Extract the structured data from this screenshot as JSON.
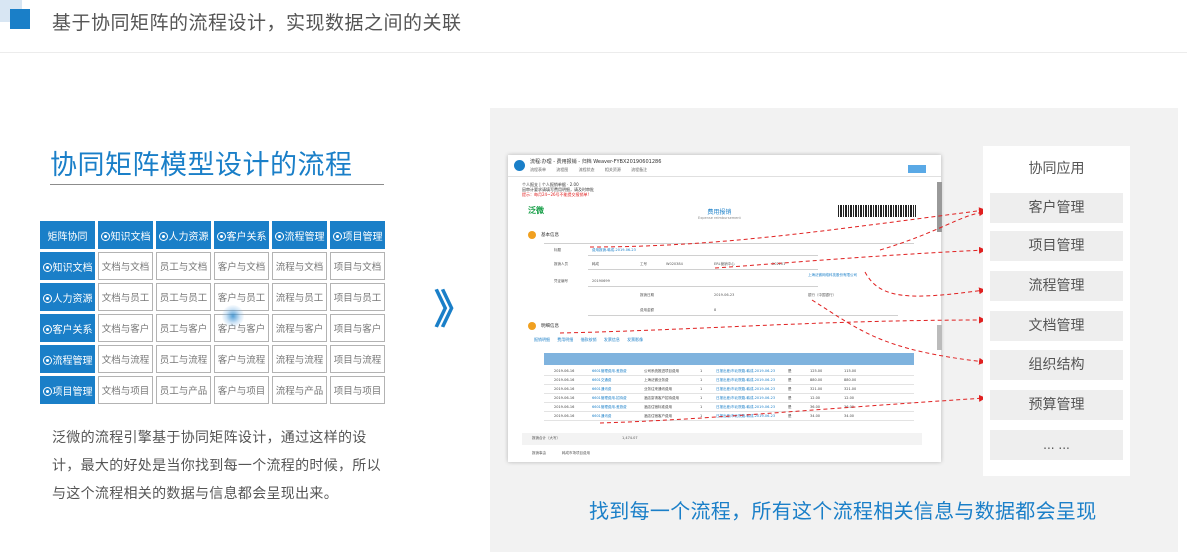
{
  "header": {
    "title": "基于协同矩阵的流程设计，实现数据之间的关联"
  },
  "section": {
    "title": "协同矩阵模型设计的流程"
  },
  "matrix": {
    "corner": "矩阵协同",
    "columns": [
      "知识文档",
      "人力资源",
      "客户关系",
      "流程管理",
      "项目管理"
    ],
    "rows": [
      {
        "label": "知识文档",
        "cells": [
          "文档与文档",
          "员工与文档",
          "客户与文档",
          "流程与文档",
          "项目与文档"
        ]
      },
      {
        "label": "人力资源",
        "cells": [
          "文档与员工",
          "员工与员工",
          "客户与员工",
          "流程与员工",
          "项目与员工"
        ]
      },
      {
        "label": "客户关系",
        "cells": [
          "文档与客户",
          "员工与客户",
          "客户与客户",
          "流程与客户",
          "项目与客户"
        ]
      },
      {
        "label": "流程管理",
        "cells": [
          "文档与流程",
          "员工与流程",
          "客户与流程",
          "流程与流程",
          "项目与流程"
        ]
      },
      {
        "label": "项目管理",
        "cells": [
          "文档与项目",
          "员工与产品",
          "客户与项目",
          "流程与产品",
          "项目与项目"
        ]
      }
    ]
  },
  "description": "泛微的流程引擎基于协同矩阵设计，通过这样的设计，最大的好处是当你找到每一个流程的时候，所以与这个流程相关的数据与信息都会呈现出来。",
  "arrow_glyph": "》",
  "screenshot": {
    "window_title": "流程:办理 - 费用报销 - 归档 Weaver-FYBX20190601286",
    "tabs": [
      "流程表单",
      "流程图",
      "流程状态",
      "相关资源",
      "流程备注"
    ],
    "meta_line1": "个人报支 | 个人报销单据 · 2.00",
    "meta_line2": "因审计要求请填写费用明细，请及时审批",
    "meta_warning": "提示：每月24~26号不能提交报销单!",
    "brand": "泛微",
    "doc_title": "费用报销",
    "doc_subtitle": "Expense reimbursement",
    "section_basic": "基本信息",
    "section_detail": "明细信息",
    "subtabs": [
      "报销明细",
      "费用明细",
      "借款核销",
      "发票信息",
      "发票影像"
    ],
    "fields": [
      {
        "label": "标题",
        "value": "费用报销-韩成-2019-06-23"
      },
      {
        "label": "报销人员",
        "value": "韩成"
      },
      {
        "label": "工号",
        "value": "W020384"
      },
      {
        "label": "报销部门",
        "value": "ERL营销中心"
      },
      {
        "label": "部门代码",
        "value": "202201"
      },
      {
        "label": "凭证编号",
        "value": "20190699"
      },
      {
        "label": "报销日期",
        "value": "2019-06-23"
      },
      {
        "label": "费用金额",
        "value": "8"
      },
      {
        "label": "开户银行",
        "value": "银行（中国银行）"
      },
      {
        "label": "公司",
        "value": "上海泛微网络科技股份有限公司"
      }
    ],
    "table_rows": [
      {
        "date": "2019-06-16",
        "code": "6601管理费用-差旅费",
        "desc": "公司系统推进项目费用",
        "qty": "1",
        "link": "日报出差/市北院路-韩成-2019-06-23",
        "flag": "是",
        "amt1": "125.00",
        "amt2": "115.00"
      },
      {
        "date": "2019-06-16",
        "code": "6601交通费",
        "desc": "上海泛微业务费",
        "qty": "1",
        "link": "日报出差/市北院路-韩成-2019-06-23",
        "flag": "是",
        "amt1": "880.00",
        "amt2": "880.00"
      },
      {
        "date": "2019-06-16",
        "code": "6601通讯费",
        "desc": "业务往来通讯费用",
        "qty": "1",
        "link": "日报出差/市北院路-韩成-2019-06-23",
        "flag": "是",
        "amt1": "321.00",
        "amt2": "321.00"
      },
      {
        "date": "2019-06-16",
        "code": "6601管理费用-招待费",
        "desc": "酒店宴请客户招待费用",
        "qty": "1",
        "link": "日报出差/市北院路-韩成-2019-06-23",
        "flag": "是",
        "amt1": "12.00",
        "amt2": "12.00"
      },
      {
        "date": "2019-06-16",
        "code": "6601管理费用-差旅费",
        "desc": "酒店住宿标准费用",
        "qty": "1",
        "link": "日报出差/市北院路-韩成-2019-06-23",
        "flag": "是",
        "amt1": "36.00",
        "amt2": "36.00"
      },
      {
        "date": "2019-06-16",
        "code": "6601通讯费",
        "desc": "酒店住宿客户费用",
        "qty": "1",
        "link": "日报出差/市北院路-韩成-2019-06-23",
        "flag": "是",
        "amt1": "34.00",
        "amt2": "34.00"
      }
    ],
    "total_label": "报销合计（大写）",
    "total_value": "1,474.07",
    "remark_label": "报销事由",
    "remark_value": "韩成市场项目费用"
  },
  "apps": {
    "title": "协同应用",
    "items": [
      "客户管理",
      "项目管理",
      "流程管理",
      "文档管理",
      "组织结构",
      "预算管理",
      "... ..."
    ]
  },
  "caption": "找到每一个流程，所有这个流程相关信息与数据都会呈现",
  "colors": {
    "brand_blue": "#1a7fc8",
    "arrow_red": "#e02020",
    "panel_bg": "#f2f2f2"
  }
}
